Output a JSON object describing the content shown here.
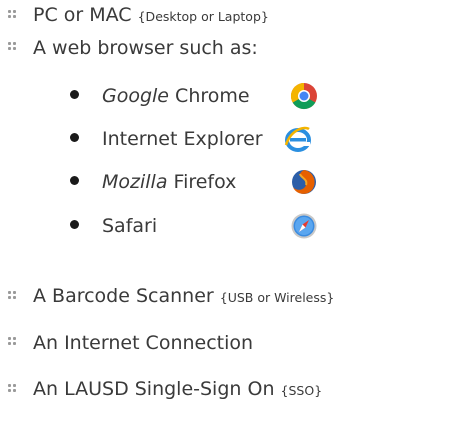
{
  "main_list": [
    {
      "text": "PC or MAC ",
      "note": "{Desktop or Laptop}"
    },
    {
      "text": "A web browser such as:",
      "note": ""
    }
  ],
  "browsers": [
    {
      "italic": "Google",
      "rest": " Chrome",
      "icon": "chrome-icon"
    },
    {
      "italic": "",
      "rest": "Internet Explorer",
      "icon": "internet-explorer-icon"
    },
    {
      "italic": "Mozilla",
      "rest": " Firefox",
      "icon": "firefox-icon"
    },
    {
      "italic": "",
      "rest": "Safari",
      "icon": "safari-icon"
    }
  ],
  "requirements": [
    {
      "text": "A Barcode Scanner ",
      "note": "{USB or Wireless}"
    },
    {
      "text": "An Internet Connection",
      "note": ""
    },
    {
      "text": "An LAUSD Single-Sign On ",
      "note": "{SSO}"
    }
  ],
  "colors": {
    "text": "#3a3a3a",
    "bullet": "#9a9a9a"
  }
}
